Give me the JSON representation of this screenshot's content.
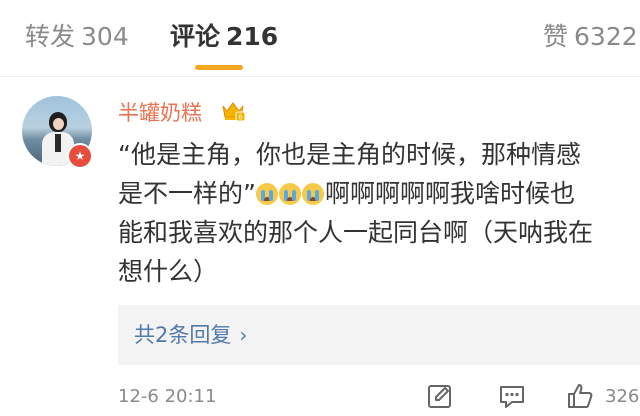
{
  "tabs": [
    {
      "label": "转发",
      "count": "304"
    },
    {
      "label": "评论",
      "count": "216"
    },
    {
      "label": "赞",
      "count": "6322"
    }
  ],
  "comment": {
    "username": "半罐奶糕",
    "lines": [
      "“他是主角，你也是主角的时候，那种情感",
      "是不一样的”",
      "啊啊啊啊啊我啥时候也",
      "能和我喜欢的那个人一起同台啊（天呐我在",
      "想什么）"
    ],
    "emojis": [
      "crying-face-icon",
      "crying-face-icon",
      "crying-face-icon"
    ],
    "replies_label": "共2条回复",
    "timestamp": "12-6 20:11",
    "like_count": "326"
  },
  "colors": {
    "accent": "#f5a623",
    "username": "#eb7350",
    "link": "#5079a8",
    "muted": "#8a8a8a"
  }
}
